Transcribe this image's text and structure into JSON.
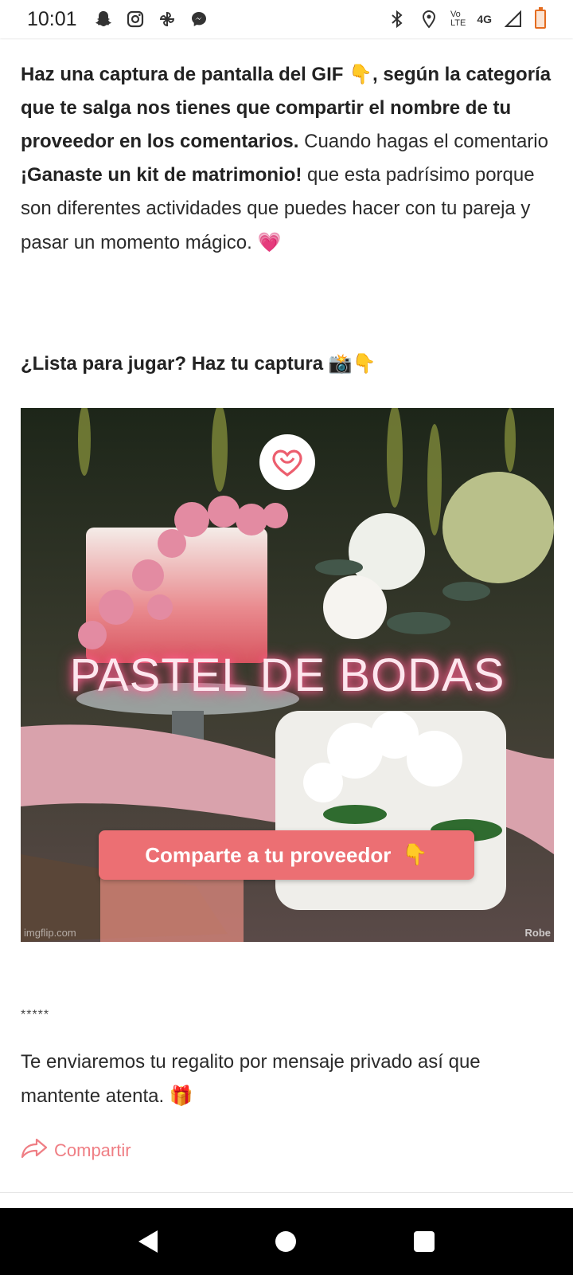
{
  "status_bar": {
    "time": "10:01",
    "left_icons": [
      "snapchat-icon",
      "instagram-icon",
      "pinwheel-icon",
      "messenger-icon"
    ],
    "volte_top": "Vo",
    "volte_bottom": "LTE",
    "network": "4G",
    "battery_color": "#e46c1f"
  },
  "article": {
    "p1_bold1": "Haz una captura de pantalla del GIF ",
    "p1_emoji1": "👇",
    "p1_bold2": ", según la categoría que te salga nos tienes que compartir el nombre de tu proveedor en los comentarios.",
    "p1_text1": " Cuando hagas el comentario ",
    "p1_bold3": "¡Ganaste un kit de matrimonio!",
    "p1_text2": " que esta padrísimo porque son diferentes actividades que puedes hacer con tu pareja y pasar un momento mágico. ",
    "p1_emoji2": "💗",
    "heading": "¿Lista para jugar? Haz tu captura ",
    "heading_emoji": "📸👇",
    "gif": {
      "title": "PASTEL DE BODAS",
      "button": "Comparte a tu proveedor",
      "button_icon": "👇",
      "watermark_left": "imgflip.com",
      "watermark_right": "Robe"
    },
    "stars": "*****",
    "p2_text": "Te enviaremos tu regalito por mensaje privado así que mantente atenta. ",
    "p2_emoji": "🎁",
    "share_label": "Compartir",
    "accent_color": "#ef7e84"
  }
}
